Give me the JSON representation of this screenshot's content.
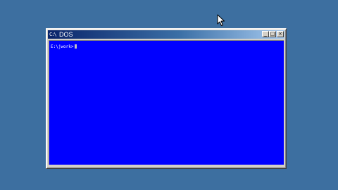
{
  "desktop": {
    "background_color": "#3d6fa0"
  },
  "window": {
    "title": "DOS",
    "title_icon": "C:\\",
    "icons": {
      "title": "dos-prompt-icon",
      "minimize": "minimize-icon",
      "maximize": "maximize-icon",
      "close": "close-icon"
    },
    "buttons": {
      "minimize": "_",
      "maximize": "□",
      "close": "×"
    },
    "console": {
      "background_color": "#0000ff",
      "prompt": "E:\\jwork>"
    }
  },
  "pointer": {
    "icon": "mouse-pointer-icon"
  }
}
